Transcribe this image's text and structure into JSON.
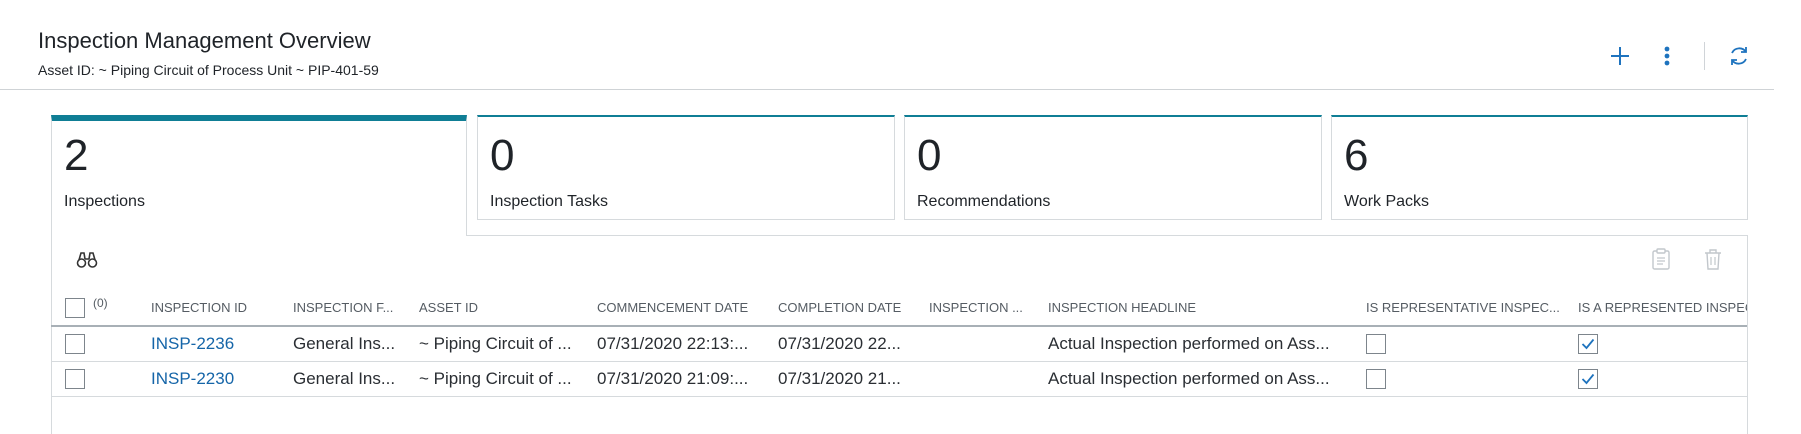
{
  "header": {
    "title": "Inspection Management Overview",
    "subtitle": "Asset ID: ~ Piping Circuit of Process Unit ~ PIP-401-59",
    "actions": [
      {
        "icon": "plus-icon",
        "label": "Add"
      },
      {
        "icon": "more-vertical-icon",
        "label": "More"
      },
      {
        "icon": "refresh-icon",
        "label": "Refresh"
      }
    ]
  },
  "cards": [
    {
      "count": "2",
      "label": "Inspections",
      "active": true
    },
    {
      "count": "0",
      "label": "Inspection Tasks",
      "active": false
    },
    {
      "count": "0",
      "label": "Recommendations",
      "active": false
    },
    {
      "count": "6",
      "label": "Work Packs",
      "active": false
    }
  ],
  "toolbar": {
    "find_icon": "binoculars-icon",
    "copy_icon": "clipboard-icon",
    "delete_icon": "trash-icon"
  },
  "grid": {
    "selected_count": "(0)",
    "columns": [
      "INSPECTION ID",
      "INSPECTION F...",
      "ASSET ID",
      "COMMENCEMENT DATE",
      "COMPLETION DATE",
      "INSPECTION ...",
      "INSPECTION HEADLINE",
      "IS REPRESENTATIVE INSPEC...",
      "IS A REPRESENTED INSPECT"
    ],
    "rows": [
      {
        "inspection_id": "INSP-2236",
        "inspection_f": "General Ins...",
        "asset_id": "~ Piping Circuit of ...",
        "commencement": "07/31/2020 22:13:...",
        "completion": "07/31/2020 22...",
        "inspection_x": "",
        "headline": "Actual Inspection performed on Ass...",
        "is_representative": false,
        "is_represented": true
      },
      {
        "inspection_id": "INSP-2230",
        "inspection_f": "General Ins...",
        "asset_id": "~ Piping Circuit of ...",
        "commencement": "07/31/2020 21:09:...",
        "completion": "07/31/2020 21...",
        "inspection_x": "",
        "headline": "Actual Inspection performed on Ass...",
        "is_representative": false,
        "is_represented": true
      }
    ]
  },
  "colors": {
    "accent": "#0f7e95",
    "link": "#1565a8",
    "icon_blue": "#1e73be",
    "border": "#d6dadd"
  }
}
